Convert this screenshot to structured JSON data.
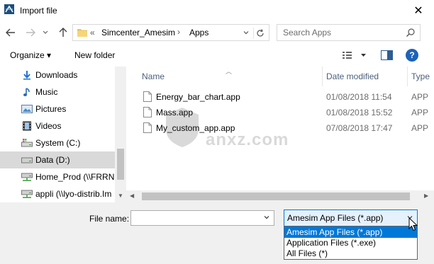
{
  "window": {
    "title": "Import file",
    "close_glyph": "✕"
  },
  "address": {
    "overflow": "«",
    "path": [
      "Simcenter_Amesim",
      "Apps"
    ],
    "separator": "›"
  },
  "search": {
    "placeholder": "Search Apps"
  },
  "toolbar": {
    "organize": "Organize ▾",
    "new_folder": "New folder",
    "help": "?"
  },
  "nav": {
    "items": [
      {
        "label": "Downloads",
        "icon": "download-arrow-icon"
      },
      {
        "label": "Music",
        "icon": "music-note-icon"
      },
      {
        "label": "Pictures",
        "icon": "pictures-icon"
      },
      {
        "label": "Videos",
        "icon": "film-strip-icon"
      },
      {
        "label": "System (C:)",
        "icon": "system-drive-icon"
      },
      {
        "label": "Data (D:)",
        "icon": "drive-icon",
        "selected": true
      },
      {
        "label": "Home_Prod (\\\\FRRNI",
        "icon": "network-drive-icon"
      },
      {
        "label": "appli (\\\\lyo-distrib.Im",
        "icon": "network-drive-icon"
      }
    ]
  },
  "columns": {
    "name": "Name",
    "date": "Date modified",
    "type": "Type"
  },
  "files": [
    {
      "name": "Energy_bar_chart.app",
      "date": "01/08/2018 11:54",
      "type": "APP"
    },
    {
      "name": "Mass.app",
      "date": "01/08/2018 15:52",
      "type": "APP"
    },
    {
      "name": "My_custom_app.app",
      "date": "07/08/2018 17:47",
      "type": "APP"
    }
  ],
  "watermark": {
    "text": "anxz.com"
  },
  "bottom": {
    "file_name_label": "File name:",
    "file_name_value": "",
    "file_type_selected": "Amesim App Files (*.app)",
    "file_type_options": [
      "Amesim App Files (*.app)",
      "Application Files (*.exe)",
      "All Files  (*)"
    ]
  },
  "colors": {
    "accent": "#0078d7",
    "selected_nav": "#d9d9d9",
    "column_header": "#4c607a",
    "help_blue": "#1e62b8"
  }
}
